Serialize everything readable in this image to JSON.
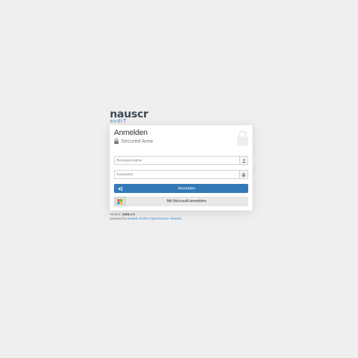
{
  "logo": {
    "word": "nauscr",
    "sub": "audiT services"
  },
  "login": {
    "title": "Anmelden",
    "subtitle": "Secured Area",
    "username_placeholder": "Benutzername",
    "password_placeholder": "Kennwort",
    "submit_label": "Anmelden",
    "microsoft_label": "Mit Microsoft anmelden"
  },
  "footer": {
    "version_label": "Version:",
    "version": "2025.1.0",
    "powered_by": "powered by",
    "company_link": "winakin GmbH",
    "separator": "|",
    "opensource_link": "OpenSource Hinweis"
  },
  "colors": {
    "primary": "#337ab7",
    "background": "#efefef",
    "ms_red": "#f25022",
    "ms_green": "#7fba00",
    "ms_blue": "#00a4ef",
    "ms_yellow": "#ffb900"
  }
}
